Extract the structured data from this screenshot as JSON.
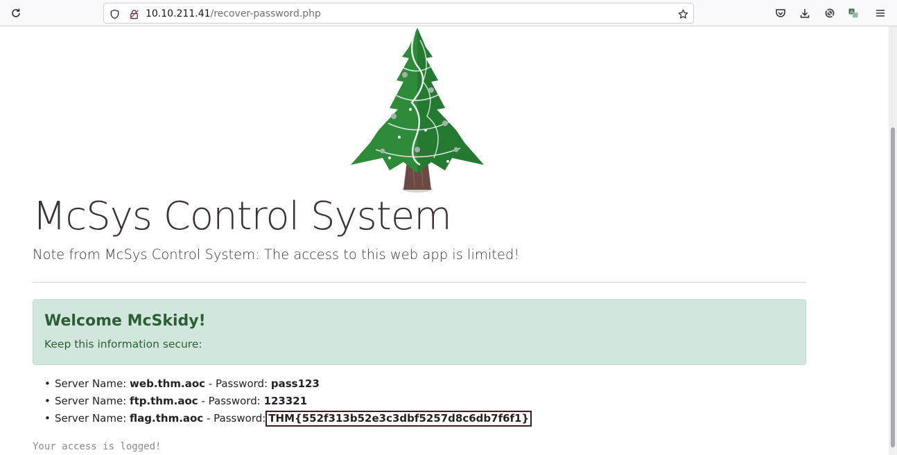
{
  "browser": {
    "url_host": "10.10.211.41",
    "url_path": "/recover-password.php",
    "icons": [
      "reload-icon",
      "shield-icon",
      "lock-icon",
      "bookmark-star-icon",
      "pocket-icon",
      "download-icon",
      "extension-icon",
      "translate-icon",
      "menu-icon"
    ]
  },
  "page": {
    "title": "McSys Control System",
    "note": "Note from McSys Control System: The access to this web app is limited!",
    "alert": {
      "heading": "Welcome McSkidy!",
      "text": "Keep this information secure:"
    },
    "servers": [
      {
        "label_name": "Server Name:",
        "name": "web.thm.aoc",
        "label_pass": "- Password:",
        "password": "pass123"
      },
      {
        "label_name": "Server Name:",
        "name": "ftp.thm.aoc",
        "label_pass": "- Password:",
        "password": "123321"
      },
      {
        "label_name": "Server Name:",
        "name": "flag.thm.aoc",
        "label_pass": "- Password:",
        "password": "THM{552f313b52e3c3dbf5257d8c6db7f6f1}"
      }
    ],
    "log_message": "Your access is logged!"
  },
  "colors": {
    "alert_bg": "#d1e7dd",
    "alert_text": "#2d5d34",
    "tree_green": "#2e8b3a"
  }
}
